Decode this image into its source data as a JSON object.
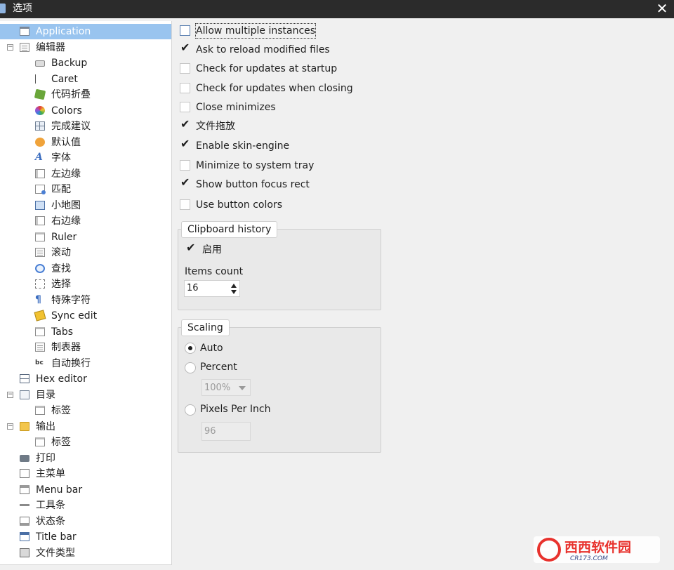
{
  "window": {
    "title": "选项",
    "close_glyph": "✕"
  },
  "tree": [
    {
      "label": "Application",
      "icon": "window-icon",
      "level": 1,
      "selected": true
    },
    {
      "label": "编辑器",
      "icon": "document-icon",
      "level": 1,
      "expander": "−"
    },
    {
      "label": "Backup",
      "icon": "drive-icon",
      "level": 2
    },
    {
      "label": "Caret",
      "icon": "caret-icon",
      "level": 2
    },
    {
      "label": "代码折叠",
      "icon": "code-folding-icon",
      "level": 2
    },
    {
      "label": "Colors",
      "icon": "color-wheel-icon",
      "level": 2
    },
    {
      "label": "完成建议",
      "icon": "grid-icon",
      "level": 2
    },
    {
      "label": "默认值",
      "icon": "paw-icon",
      "level": 2
    },
    {
      "label": "字体",
      "icon": "font-icon",
      "level": 2
    },
    {
      "label": "左边缘",
      "icon": "left-margin-icon",
      "level": 2
    },
    {
      "label": "匹配",
      "icon": "match-icon",
      "level": 2
    },
    {
      "label": "小地图",
      "icon": "minimap-icon",
      "level": 2
    },
    {
      "label": "右边缘",
      "icon": "right-margin-icon",
      "level": 2
    },
    {
      "label": "Ruler",
      "icon": "ruler-icon",
      "level": 2
    },
    {
      "label": "滚动",
      "icon": "scroll-icon",
      "level": 2
    },
    {
      "label": "查找",
      "icon": "find-icon",
      "level": 2
    },
    {
      "label": "选择",
      "icon": "selection-icon",
      "level": 2
    },
    {
      "label": "特殊字符",
      "icon": "pilcrow-icon",
      "level": 2
    },
    {
      "label": "Sync edit",
      "icon": "sync-edit-icon",
      "level": 2
    },
    {
      "label": "Tabs",
      "icon": "tabs-icon",
      "level": 2
    },
    {
      "label": "制表器",
      "icon": "tabulator-icon",
      "level": 2
    },
    {
      "label": "自动换行",
      "icon": "word-wrap-icon",
      "level": 2
    },
    {
      "label": "Hex editor",
      "icon": "hex-editor-icon",
      "level": 1
    },
    {
      "label": "目录",
      "icon": "tree-view-icon",
      "level": 1,
      "expander": "−"
    },
    {
      "label": "标签",
      "icon": "tab-icon",
      "level": 2
    },
    {
      "label": "输出",
      "icon": "folder-icon",
      "level": 1,
      "expander": "−"
    },
    {
      "label": "标签",
      "icon": "tab-icon",
      "level": 2
    },
    {
      "label": "打印",
      "icon": "printer-icon",
      "level": 0
    },
    {
      "label": "主菜单",
      "icon": "main-menu-icon",
      "level": 0
    },
    {
      "label": "Menu bar",
      "icon": "menu-bar-icon",
      "level": 0
    },
    {
      "label": "工具条",
      "icon": "toolbar-icon",
      "level": 0
    },
    {
      "label": "状态条",
      "icon": "status-bar-icon",
      "level": 0
    },
    {
      "label": "Title bar",
      "icon": "title-bar-icon",
      "level": 0
    },
    {
      "label": "文件类型",
      "icon": "file-type-icon",
      "level": 0
    }
  ],
  "options": [
    {
      "label": "Allow multiple instances",
      "checked": false
    },
    {
      "label": "Ask to reload modified files",
      "checked": true
    },
    {
      "label": "Check for updates at startup",
      "checked": false
    },
    {
      "label": "Check for updates when closing",
      "checked": false
    },
    {
      "label": "Close minimizes",
      "checked": false
    },
    {
      "label": "文件拖放",
      "checked": true
    },
    {
      "label": "Enable skin-engine",
      "checked": true
    },
    {
      "label": "Minimize to system tray",
      "checked": false
    },
    {
      "label": "Show button focus rect",
      "checked": true
    },
    {
      "label": "Use button colors",
      "checked": false
    }
  ],
  "clipboard_history": {
    "caption": "Clipboard history",
    "enable_label": "启用",
    "enable_checked": true,
    "items_count_label": "Items count",
    "items_count_value": "16"
  },
  "scaling": {
    "caption": "Scaling",
    "auto_label": "Auto",
    "percent_label": "Percent",
    "percent_value": "100%",
    "ppi_label": "Pixels Per Inch",
    "ppi_value": "96",
    "selected": "Auto"
  },
  "watermark": {
    "brand": "西西软件园",
    "domain": "CR173.COM"
  },
  "colors": {
    "selection": "#99c4ef",
    "titlebar": "#2b2b2b",
    "watermark_red": "#e8322d"
  }
}
